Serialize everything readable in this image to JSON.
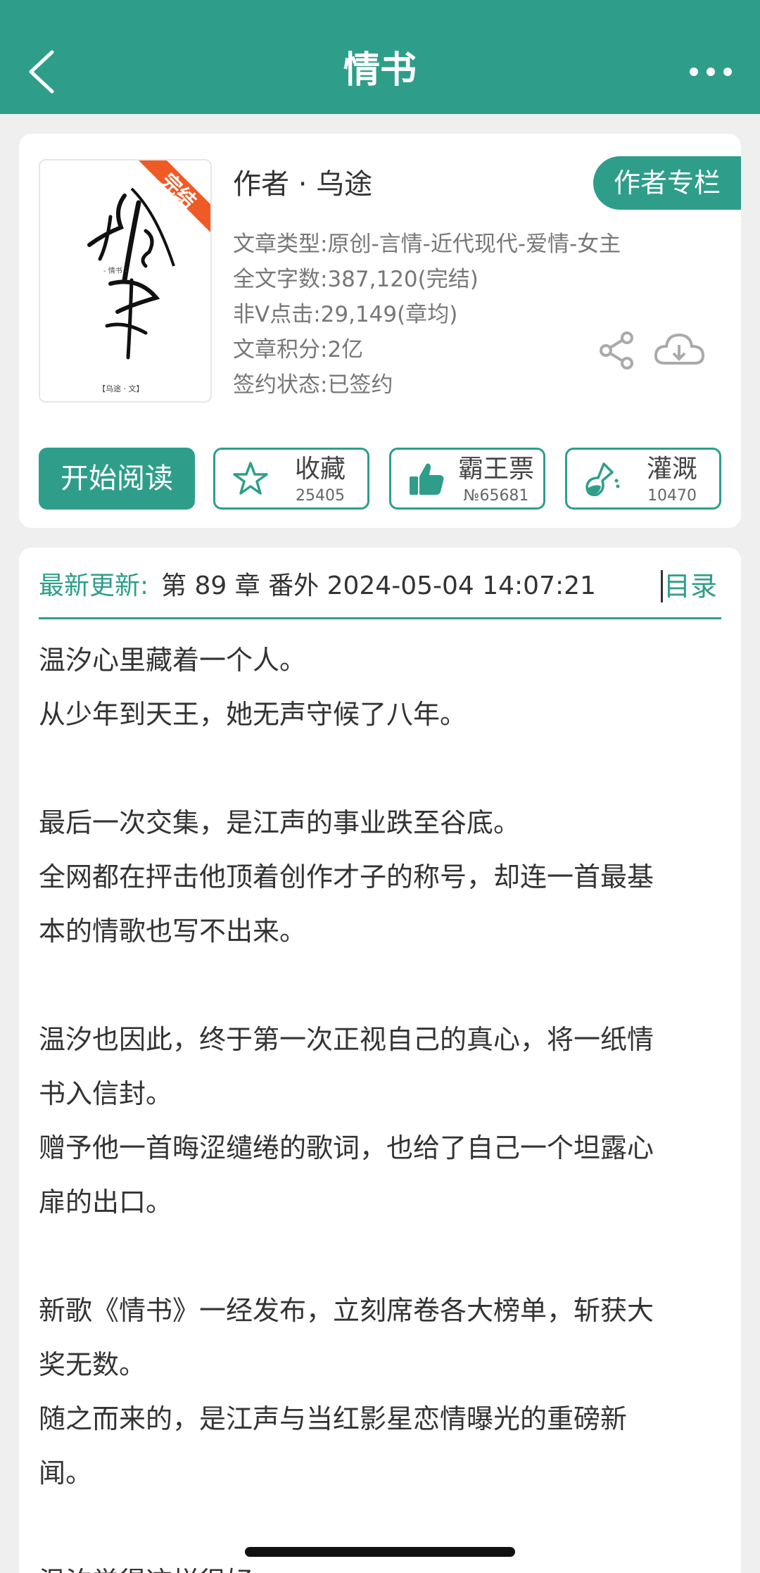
{
  "header": {
    "title": "情书",
    "back_icon": "chevron-left-icon",
    "more_icon": "more-dots-icon"
  },
  "book": {
    "cover_badge": "完结",
    "cover_title_glyph": "情书",
    "cover_small": "- 情书 -",
    "cover_author": "【乌途 · 文】",
    "author": "作者 · 乌途",
    "author_column_label": "作者专栏",
    "meta": [
      "文章类型:原创-言情-近代现代-爱情-女主",
      "全文字数:387,120(完结)",
      "非V点击:29,149(章均)",
      "文章积分:2亿",
      "签约状态:已签约"
    ],
    "share_icon": "share-icon",
    "download_icon": "cloud-download-icon"
  },
  "actions": {
    "read_label": "开始阅读",
    "favorite": {
      "label": "收藏",
      "count": "25405",
      "icon": "star-icon"
    },
    "vote": {
      "label": "霸王票",
      "count": "№65681",
      "icon": "thumbs-up-icon"
    },
    "water": {
      "label": "灌溉",
      "count": "10470",
      "icon": "flask-icon"
    }
  },
  "latest": {
    "label": "最新更新:",
    "text": "第 89 章  番外 2024-05-04 14:07:21",
    "toc_label": "目录"
  },
  "synopsis": [
    "温汐心里藏着一个人。",
    "从少年到天王，她无声守候了八年。",
    "",
    "最后一次交集，是江声的事业跌至谷底。",
    "全网都在抨击他顶着创作才子的称号，却连一首最基",
    "本的情歌也写不出来。",
    "",
    "温汐也因此，终于第一次正视自己的真心，将一纸情",
    "书入信封。",
    "赠予他一首晦涩缱绻的歌词，也给了自己一个坦露心",
    "扉的出口。",
    "",
    "新歌《情书》一经发布，立刻席卷各大榜单，斩获大",
    "奖无数。",
    "随之而来的，是江声与当红影星恋情曝光的重磅新",
    "闻。",
    "",
    "温汐觉得这样很好。"
  ],
  "colors": {
    "accent": "#2e9e8a",
    "badge": "#f05a24",
    "background": "#efefef"
  }
}
